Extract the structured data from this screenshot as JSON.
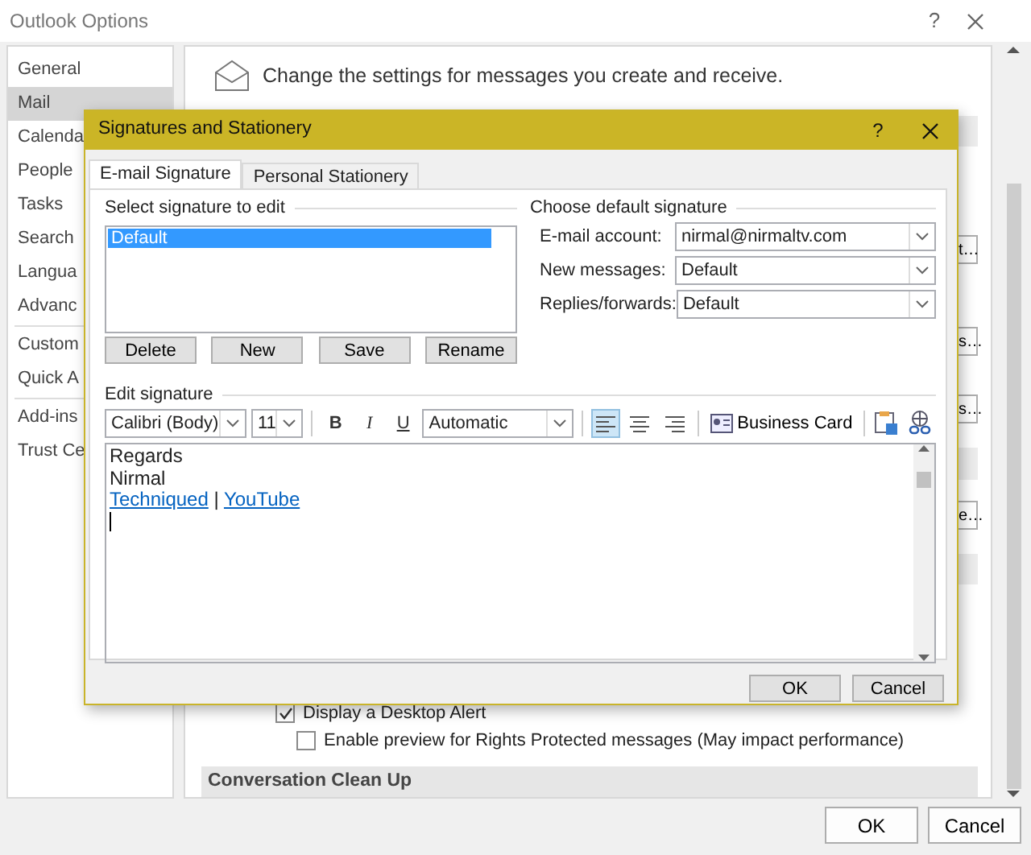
{
  "window": {
    "title": "Outlook Options",
    "help": "?"
  },
  "sidebar": {
    "items": [
      {
        "label": "General",
        "selected": false
      },
      {
        "label": "Mail",
        "selected": true
      },
      {
        "label": "Calenda",
        "selected": false
      },
      {
        "label": "People",
        "selected": false
      },
      {
        "label": "Tasks",
        "selected": false
      },
      {
        "label": "Search",
        "selected": false
      },
      {
        "label": "Langua",
        "selected": false
      },
      {
        "label": "Advanc",
        "selected": false
      },
      {
        "label": "Custom",
        "selected": false
      },
      {
        "label": "Quick A",
        "selected": false
      },
      {
        "label": "Add-ins",
        "selected": false
      },
      {
        "label": "Trust Ce",
        "selected": false
      }
    ]
  },
  "content": {
    "intro": "Change the settings for messages you create and receive.",
    "side_buttons": [
      "t…",
      "s…",
      "s…",
      "e…"
    ],
    "options": [
      {
        "label": "Display a Desktop Alert",
        "checked": true,
        "children": [
          {
            "label": "Enable preview for Rights Protected messages (May impact performance)",
            "checked": false
          }
        ]
      }
    ],
    "section_title": "Conversation Clean Up"
  },
  "buttons": [
    "OK",
    "Cancel"
  ],
  "dialog": {
    "title": "Signatures and Stationery",
    "help": "?",
    "tabs": [
      {
        "label": "E-mail Signature",
        "selected": true
      },
      {
        "label": "Personal Stationery",
        "selected": false
      }
    ],
    "signature_list": {
      "heading": "Select signature to edit",
      "items": [
        {
          "name": "Default",
          "selected": true
        }
      ],
      "buttons": [
        "Delete",
        "New",
        "Save",
        "Rename"
      ]
    },
    "default_signature": {
      "heading": "Choose default signature",
      "fields": [
        {
          "label": "E-mail account:",
          "value": "nirmal@nirmaltv.com"
        },
        {
          "label": "New messages:",
          "value": "Default"
        },
        {
          "label": "Replies/forwards:",
          "value": "Default"
        }
      ]
    },
    "editor": {
      "heading": "Edit signature",
      "toolbar": {
        "font": "Calibri (Body)",
        "size": "11",
        "format_buttons": [
          {
            "kind": "bold",
            "label": "B"
          },
          {
            "kind": "italic",
            "label": "I"
          },
          {
            "kind": "underline",
            "label": "U"
          }
        ],
        "text_color": "Automatic",
        "alignment": [
          {
            "kind": "left",
            "selected": true
          },
          {
            "kind": "center",
            "selected": false
          },
          {
            "kind": "right",
            "selected": false
          }
        ],
        "business_card": "Business Card"
      },
      "lines": [
        {
          "kind": "text",
          "text": "Regards"
        },
        {
          "kind": "text",
          "text": "Nirmal"
        },
        {
          "kind": "links",
          "links": [
            "Techniqued",
            "YouTube"
          ],
          "separator": "|"
        }
      ]
    },
    "buttons": [
      "OK",
      "Cancel"
    ]
  }
}
